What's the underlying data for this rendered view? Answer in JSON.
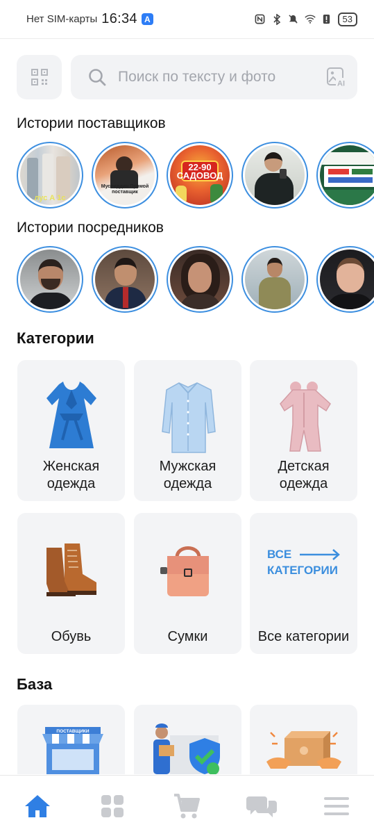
{
  "status_bar": {
    "carrier": "Нет SIM-карты",
    "time": "16:34",
    "battery": "53"
  },
  "search": {
    "placeholder": "Поиск по тексту и фото"
  },
  "sections": {
    "supplier_stories": "Истории поставщиков",
    "intermediary_stories": "Истории посредников",
    "categories": "Категории",
    "base": "База"
  },
  "supplier_stories": [
    {
      "name": "textile-supplier",
      "caption": "лус А 1с"
    },
    {
      "name": "muslidin-supplier",
      "caption": "Муслиддин Прямой поставщик"
    },
    {
      "name": "sadovod-prices",
      "caption": "22-90 САДОВОД"
    },
    {
      "name": "young-man-supplier",
      "caption": ""
    },
    {
      "name": "store-sign-supplier",
      "caption": ""
    }
  ],
  "intermediary_stories": [
    {
      "name": "intermediary-1"
    },
    {
      "name": "intermediary-2"
    },
    {
      "name": "intermediary-3"
    },
    {
      "name": "intermediary-4"
    },
    {
      "name": "intermediary-5"
    }
  ],
  "categories": [
    {
      "label": "Женская одежда",
      "icon": "dress-icon"
    },
    {
      "label": "Мужская одежда",
      "icon": "shirt-icon"
    },
    {
      "label": "Детская одежда",
      "icon": "baby-romper-icon"
    },
    {
      "label": "Обувь",
      "icon": "boots-icon"
    },
    {
      "label": "Сумки",
      "icon": "bag-icon"
    },
    {
      "label": "Все категории",
      "icon": "arrow-right-icon",
      "badge_line1": "ВСЕ",
      "badge_line2": "КАТЕГОРИИ"
    }
  ],
  "base_cards": [
    {
      "icon": "suppliers-store-icon",
      "sign": "ПОСТАВЩИКИ"
    },
    {
      "icon": "delivery-guarantee-icon"
    },
    {
      "icon": "package-hands-icon"
    }
  ],
  "bottom_nav": [
    {
      "name": "home",
      "active": true
    },
    {
      "name": "catalog",
      "active": false
    },
    {
      "name": "cart",
      "active": false
    },
    {
      "name": "chat",
      "active": false
    },
    {
      "name": "menu",
      "active": false
    }
  ],
  "colors": {
    "accent": "#2f7fe4",
    "story_ring": "#3d8fe0",
    "card_bg": "#f3f4f6",
    "nav_inactive": "#c9cbcf"
  }
}
